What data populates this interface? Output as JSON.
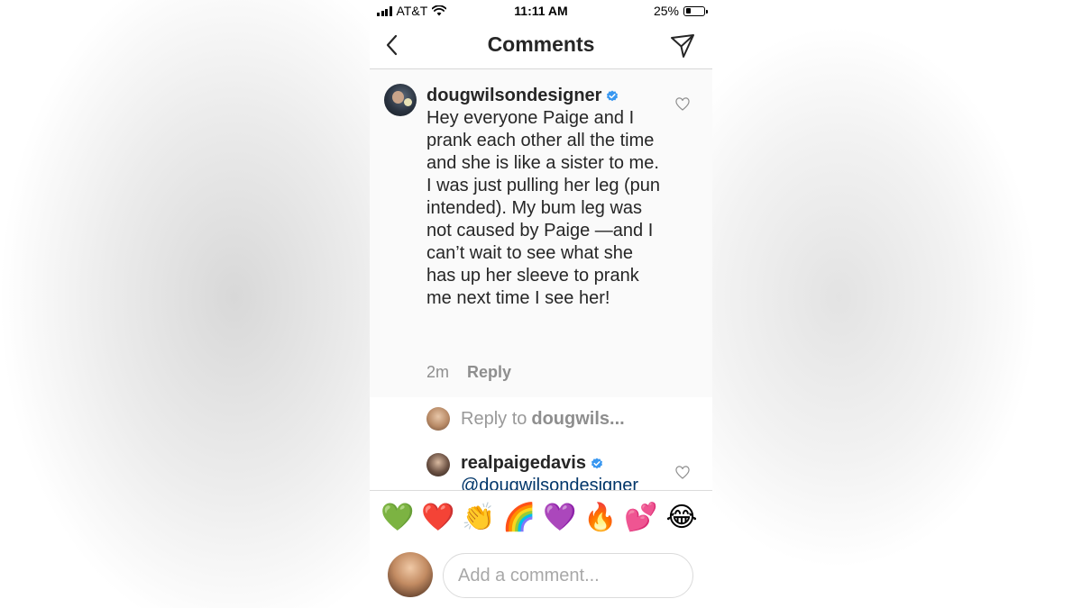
{
  "status_bar": {
    "carrier": "AT&T",
    "time": "11:11 AM",
    "battery": "25%",
    "battery_level": 0.25
  },
  "header": {
    "title": "Comments",
    "back_icon": "chevron-left-icon",
    "send_icon": "paper-plane-icon"
  },
  "main_comment": {
    "username": "dougwilsondesigner",
    "verified": true,
    "text": "Hey everyone Paige and I prank each other all the time and she is like a sister to me. I was just pulling her leg (pun intended). My bum leg was not caused by Paige —and I can’t wait to see what she has up her sleeve to prank me next time I see her!",
    "time": "2m",
    "reply_label": "Reply"
  },
  "reply_to": {
    "prefix": "Reply to",
    "name": "dougwils..."
  },
  "second_comment": {
    "username": "realpaigedavis",
    "verified": true,
    "mention": "@dougwilsondesigner"
  },
  "emojis": [
    "💚",
    "❤️",
    "👏",
    "🌈",
    "💜",
    "🔥",
    "💕",
    "😂"
  ],
  "add_comment": {
    "placeholder": "Add a comment..."
  },
  "colors": {
    "verified": "#3897f0",
    "mention": "#003569",
    "text": "#262626",
    "muted": "#8e8e8e"
  }
}
